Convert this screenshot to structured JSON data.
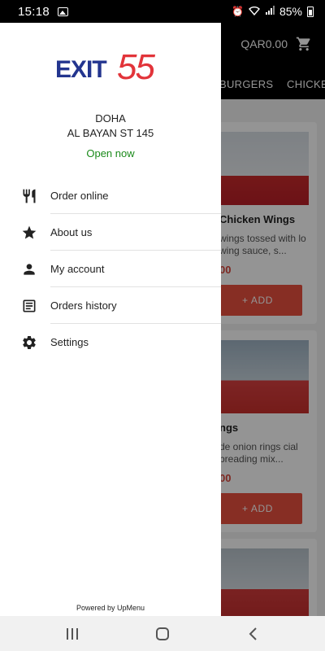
{
  "status_bar": {
    "time": "15:18",
    "battery": "85%",
    "icons": [
      "image-icon",
      "alarm-icon",
      "wifi-icon",
      "signal-icon",
      "battery-charging-icon"
    ]
  },
  "app": {
    "cart_total": "QAR0.00",
    "categories": [
      "BURGERS",
      "CHICKEN"
    ],
    "products": [
      {
        "title": "Chicken Wings",
        "desc": "wings tossed with lo wing sauce, s...",
        "price": "00",
        "add_label": "+ ADD"
      },
      {
        "title": "ngs",
        "desc": "de onion rings cial breading mix...",
        "price": "00",
        "add_label": "+ ADD"
      }
    ]
  },
  "drawer": {
    "logo_text": "EXIT",
    "logo_number": "55",
    "city": "DOHA",
    "street": "AL BAYAN ST 145",
    "open_status": "Open now",
    "menu": [
      {
        "label": "Order online",
        "icon": "utensils-icon"
      },
      {
        "label": "About us",
        "icon": "star-icon"
      },
      {
        "label": "My account",
        "icon": "person-icon"
      },
      {
        "label": "Orders history",
        "icon": "list-icon"
      },
      {
        "label": "Settings",
        "icon": "gear-icon"
      }
    ],
    "powered_by": "Powered by UpMenu"
  },
  "colors": {
    "accent": "#e8503f",
    "open_green": "#1a8a1a",
    "logo_blue": "#23358f",
    "logo_red": "#e2343a"
  }
}
